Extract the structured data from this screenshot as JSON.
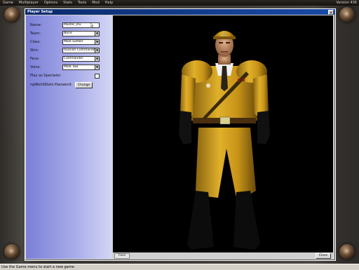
{
  "menubar": {
    "items": [
      "Game",
      "Multiplayer",
      "Options",
      "Stats",
      "Tools",
      "Mod",
      "Help"
    ],
    "version": "Version 436"
  },
  "dialog": {
    "title": "Player Setup",
    "close_glyph": "x",
    "fields": {
      "name": {
        "label": "Name:",
        "value": "Master_mx"
      },
      "team": {
        "label": "Team:",
        "value": "None"
      },
      "class": {
        "label": "Class:",
        "value": "Male Soldier"
      },
      "skin": {
        "label": "Skin:",
        "value": "Russian Commander"
      },
      "face": {
        "label": "Face:",
        "value": "Commander"
      },
      "voice": {
        "label": "Voice:",
        "value": "Male Two"
      },
      "spectator": {
        "label": "Play as Spectator",
        "checked": false
      },
      "password": {
        "label": "ngWorldStats Password:",
        "button": "Change"
      }
    },
    "face_tab": "Face",
    "close_button": "Close"
  },
  "status": {
    "text": "Use the Game menu to start a new game."
  },
  "colors": {
    "uniform": "#d4a21e",
    "panel_gradient_start": "#7b7fd8",
    "titlebar": "#0a2a6a"
  }
}
